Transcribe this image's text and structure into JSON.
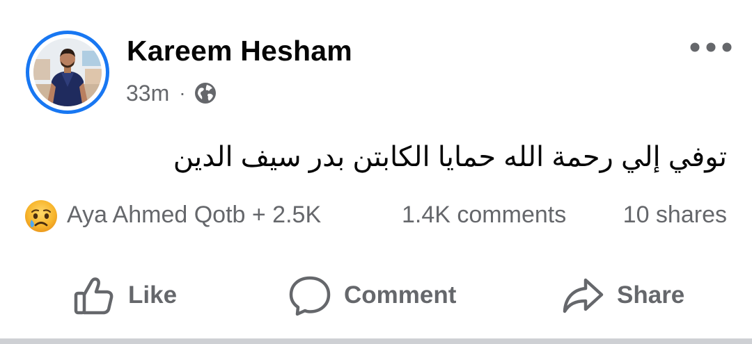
{
  "post": {
    "author": {
      "name": "Kareem Hesham",
      "avatar_icon": "profile-photo",
      "story_ring_color": "#1877f2"
    },
    "timestamp": "33m",
    "meta_separator": "·",
    "audience_icon": "globe-icon",
    "more_icon": "more-options-icon",
    "text": "توفي إلي رحمة الله حمايا الكابتن بدر سيف الدين"
  },
  "stats": {
    "reaction_icon": "sad-emoji",
    "reactions_summary": "Aya Ahmed Qotb + 2.5K",
    "comments": "1.4K comments",
    "shares": "10 shares"
  },
  "actions": {
    "like_label": "Like",
    "comment_label": "Comment",
    "share_label": "Share"
  },
  "colors": {
    "accent": "#1877f2",
    "text_primary": "#050505",
    "text_secondary": "#65676b",
    "divider": "#ced0d4"
  }
}
